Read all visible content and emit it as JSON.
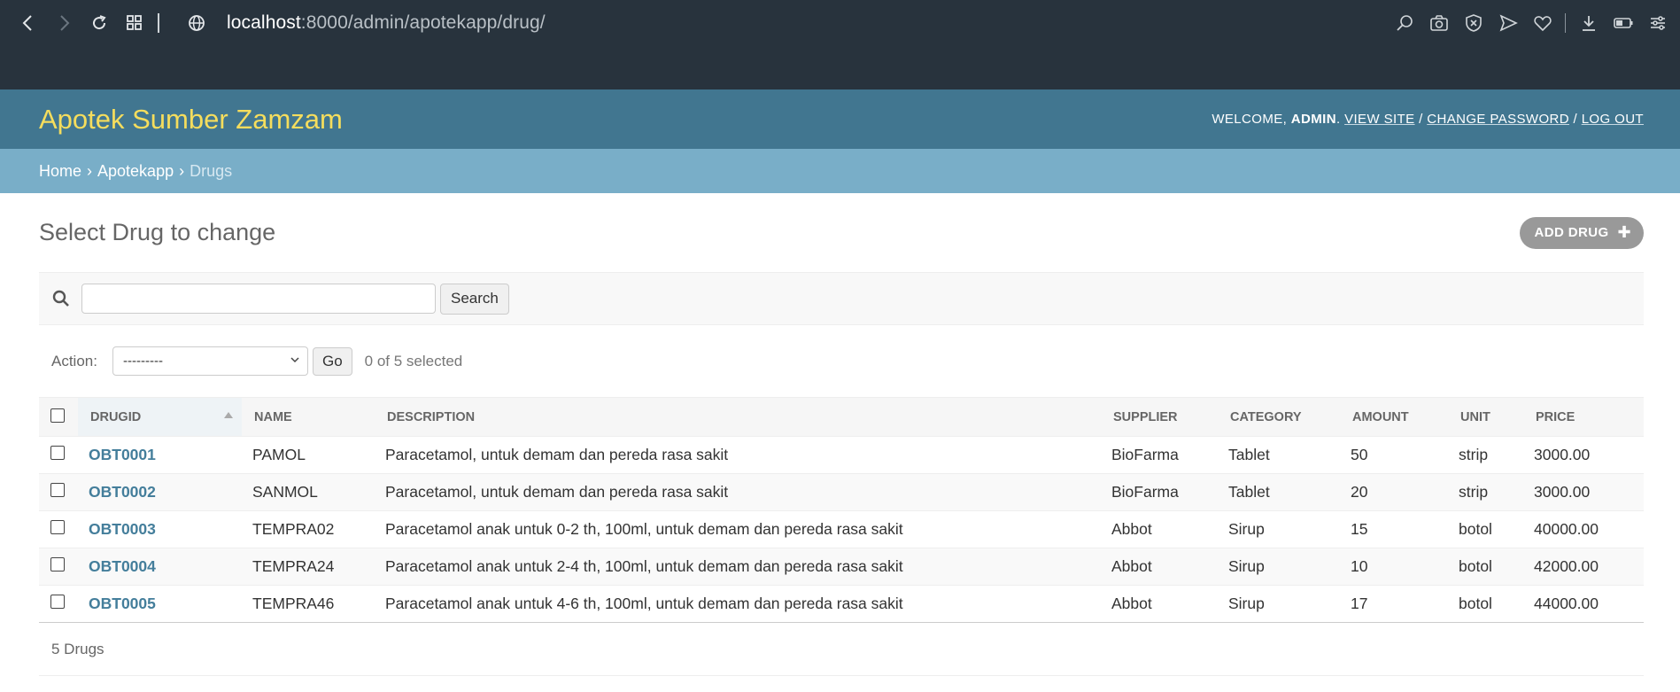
{
  "browser": {
    "url_host": "localhost",
    "url_rest": ":8000/admin/apotekapp/drug/"
  },
  "header": {
    "brand": "Apotek Sumber Zamzam",
    "welcome_prefix": "WELCOME, ",
    "username": "ADMIN",
    "dot": ". ",
    "view_site": "VIEW SITE",
    "slash1": " / ",
    "change_password": "CHANGE PASSWORD",
    "slash2": " / ",
    "log_out": "LOG OUT"
  },
  "breadcrumbs": {
    "home": "Home",
    "sep1": "›",
    "app": "Apotekapp",
    "sep2": "›",
    "current": "Drugs"
  },
  "page": {
    "title": "Select Drug to change",
    "add_label": "ADD DRUG",
    "add_plus": "✚"
  },
  "search": {
    "value": "",
    "placeholder": "",
    "button": "Search"
  },
  "actions": {
    "label": "Action:",
    "selected_option": "---------",
    "go": "Go",
    "selected_count": "0 of 5 selected"
  },
  "table": {
    "columns": [
      "DRUGID",
      "NAME",
      "DESCRIPTION",
      "SUPPLIER",
      "CATEGORY",
      "AMOUNT",
      "UNIT",
      "PRICE"
    ],
    "rows": [
      {
        "id": "OBT0001",
        "name": "PAMOL",
        "description": "Paracetamol, untuk demam dan pereda rasa sakit",
        "supplier": "BioFarma",
        "category": "Tablet",
        "amount": "50",
        "unit": "strip",
        "price": "3000.00"
      },
      {
        "id": "OBT0002",
        "name": "SANMOL",
        "description": "Paracetamol, untuk demam dan pereda rasa sakit",
        "supplier": "BioFarma",
        "category": "Tablet",
        "amount": "20",
        "unit": "strip",
        "price": "3000.00"
      },
      {
        "id": "OBT0003",
        "name": "TEMPRA02",
        "description": "Paracetamol anak untuk 0-2 th, 100ml, untuk demam dan pereda rasa sakit",
        "supplier": "Abbot",
        "category": "Sirup",
        "amount": "15",
        "unit": "botol",
        "price": "40000.00"
      },
      {
        "id": "OBT0004",
        "name": "TEMPRA24",
        "description": "Paracetamol anak untuk 2-4 th, 100ml, untuk demam dan pereda rasa sakit",
        "supplier": "Abbot",
        "category": "Sirup",
        "amount": "10",
        "unit": "botol",
        "price": "42000.00"
      },
      {
        "id": "OBT0005",
        "name": "TEMPRA46",
        "description": "Paracetamol anak untuk 4-6 th, 100ml, untuk demam dan pereda rasa sakit",
        "supplier": "Abbot",
        "category": "Sirup",
        "amount": "17",
        "unit": "botol",
        "price": "44000.00"
      }
    ]
  },
  "paginator": {
    "count": "5 Drugs"
  },
  "colors": {
    "header_bg": "#417690",
    "brand": "#f5dd5d",
    "breadcrumb_bg": "#79aec8",
    "link": "#447e9b",
    "browser_bg": "#28333d"
  }
}
